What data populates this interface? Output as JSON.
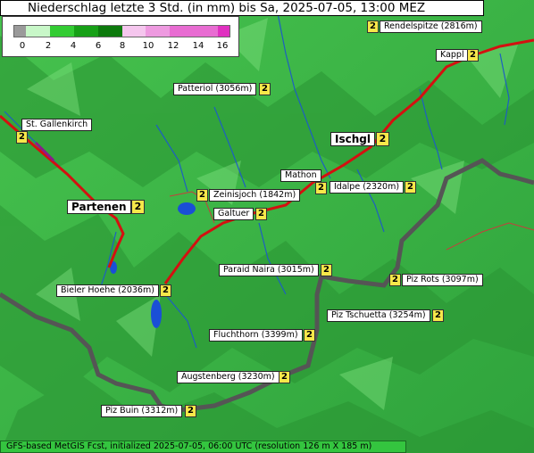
{
  "title": "Niederschlag letzte 3 Std. (in mm) bis Sa, 2025-07-05, 13:00 MEZ",
  "legend": {
    "ticks": [
      "0",
      "2",
      "4",
      "6",
      "8",
      "10",
      "12",
      "14",
      "16"
    ],
    "colors": [
      "#9a9a9a",
      "#c8f7c8",
      "#7cea7c",
      "#33cc33",
      "#17a017",
      "#0d7a0d",
      "#f5c6ee",
      "#ee9ae0",
      "#e86cd2",
      "#e030c0"
    ]
  },
  "places": [
    {
      "name": "Rendelspitze (2816m)",
      "value": "2"
    },
    {
      "name": "Kappl",
      "value": "2"
    },
    {
      "name": "Patteriol (3056m)",
      "value": "2"
    },
    {
      "name": "St. Gallenkirch",
      "value": "2"
    },
    {
      "name": "Ischgl",
      "value": "2"
    },
    {
      "name": "Mathon",
      "value": "2"
    },
    {
      "name": "Idalpe (2320m)",
      "value": "2"
    },
    {
      "name": "Zeinisjoch (1842m)",
      "value": "2"
    },
    {
      "name": "Partenen",
      "value": "2"
    },
    {
      "name": "Galtuer",
      "value": "2"
    },
    {
      "name": "Paraid Naira (3015m)",
      "value": "2"
    },
    {
      "name": "Piz Rots (3097m)",
      "value": "2"
    },
    {
      "name": "Bieler Hoehe (2036m)",
      "value": "2"
    },
    {
      "name": "Piz Tschuetta (3254m)",
      "value": "2"
    },
    {
      "name": "Fluchthorn (3399m)",
      "value": "2"
    },
    {
      "name": "Augstenberg (3230m)",
      "value": "2"
    },
    {
      "name": "Piz Buin (3312m)",
      "value": "2"
    }
  ],
  "footer": "GFS-based MetGIS Fcst, initialized 2025-07-05, 06:00 UTC  (resolution 126 m X 185 m)"
}
